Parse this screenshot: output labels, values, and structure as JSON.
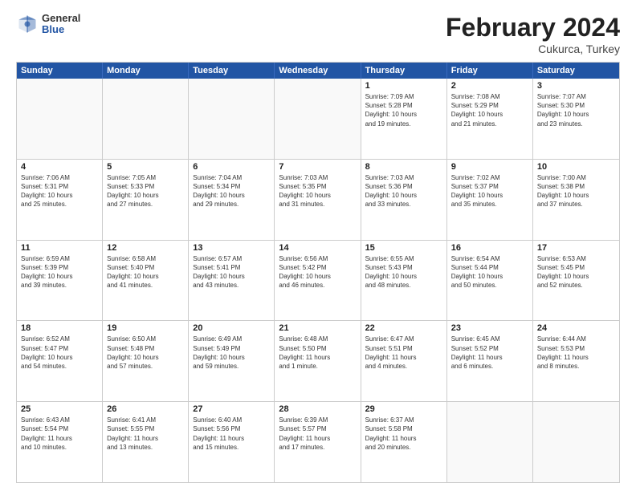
{
  "header": {
    "logo_general": "General",
    "logo_blue": "Blue",
    "title": "February 2024",
    "subtitle": "Cukurca, Turkey"
  },
  "days_of_week": [
    "Sunday",
    "Monday",
    "Tuesday",
    "Wednesday",
    "Thursday",
    "Friday",
    "Saturday"
  ],
  "weeks": [
    [
      {
        "day": "",
        "info": ""
      },
      {
        "day": "",
        "info": ""
      },
      {
        "day": "",
        "info": ""
      },
      {
        "day": "",
        "info": ""
      },
      {
        "day": "1",
        "info": "Sunrise: 7:09 AM\nSunset: 5:28 PM\nDaylight: 10 hours\nand 19 minutes."
      },
      {
        "day": "2",
        "info": "Sunrise: 7:08 AM\nSunset: 5:29 PM\nDaylight: 10 hours\nand 21 minutes."
      },
      {
        "day": "3",
        "info": "Sunrise: 7:07 AM\nSunset: 5:30 PM\nDaylight: 10 hours\nand 23 minutes."
      }
    ],
    [
      {
        "day": "4",
        "info": "Sunrise: 7:06 AM\nSunset: 5:31 PM\nDaylight: 10 hours\nand 25 minutes."
      },
      {
        "day": "5",
        "info": "Sunrise: 7:05 AM\nSunset: 5:33 PM\nDaylight: 10 hours\nand 27 minutes."
      },
      {
        "day": "6",
        "info": "Sunrise: 7:04 AM\nSunset: 5:34 PM\nDaylight: 10 hours\nand 29 minutes."
      },
      {
        "day": "7",
        "info": "Sunrise: 7:03 AM\nSunset: 5:35 PM\nDaylight: 10 hours\nand 31 minutes."
      },
      {
        "day": "8",
        "info": "Sunrise: 7:03 AM\nSunset: 5:36 PM\nDaylight: 10 hours\nand 33 minutes."
      },
      {
        "day": "9",
        "info": "Sunrise: 7:02 AM\nSunset: 5:37 PM\nDaylight: 10 hours\nand 35 minutes."
      },
      {
        "day": "10",
        "info": "Sunrise: 7:00 AM\nSunset: 5:38 PM\nDaylight: 10 hours\nand 37 minutes."
      }
    ],
    [
      {
        "day": "11",
        "info": "Sunrise: 6:59 AM\nSunset: 5:39 PM\nDaylight: 10 hours\nand 39 minutes."
      },
      {
        "day": "12",
        "info": "Sunrise: 6:58 AM\nSunset: 5:40 PM\nDaylight: 10 hours\nand 41 minutes."
      },
      {
        "day": "13",
        "info": "Sunrise: 6:57 AM\nSunset: 5:41 PM\nDaylight: 10 hours\nand 43 minutes."
      },
      {
        "day": "14",
        "info": "Sunrise: 6:56 AM\nSunset: 5:42 PM\nDaylight: 10 hours\nand 46 minutes."
      },
      {
        "day": "15",
        "info": "Sunrise: 6:55 AM\nSunset: 5:43 PM\nDaylight: 10 hours\nand 48 minutes."
      },
      {
        "day": "16",
        "info": "Sunrise: 6:54 AM\nSunset: 5:44 PM\nDaylight: 10 hours\nand 50 minutes."
      },
      {
        "day": "17",
        "info": "Sunrise: 6:53 AM\nSunset: 5:45 PM\nDaylight: 10 hours\nand 52 minutes."
      }
    ],
    [
      {
        "day": "18",
        "info": "Sunrise: 6:52 AM\nSunset: 5:47 PM\nDaylight: 10 hours\nand 54 minutes."
      },
      {
        "day": "19",
        "info": "Sunrise: 6:50 AM\nSunset: 5:48 PM\nDaylight: 10 hours\nand 57 minutes."
      },
      {
        "day": "20",
        "info": "Sunrise: 6:49 AM\nSunset: 5:49 PM\nDaylight: 10 hours\nand 59 minutes."
      },
      {
        "day": "21",
        "info": "Sunrise: 6:48 AM\nSunset: 5:50 PM\nDaylight: 11 hours\nand 1 minute."
      },
      {
        "day": "22",
        "info": "Sunrise: 6:47 AM\nSunset: 5:51 PM\nDaylight: 11 hours\nand 4 minutes."
      },
      {
        "day": "23",
        "info": "Sunrise: 6:45 AM\nSunset: 5:52 PM\nDaylight: 11 hours\nand 6 minutes."
      },
      {
        "day": "24",
        "info": "Sunrise: 6:44 AM\nSunset: 5:53 PM\nDaylight: 11 hours\nand 8 minutes."
      }
    ],
    [
      {
        "day": "25",
        "info": "Sunrise: 6:43 AM\nSunset: 5:54 PM\nDaylight: 11 hours\nand 10 minutes."
      },
      {
        "day": "26",
        "info": "Sunrise: 6:41 AM\nSunset: 5:55 PM\nDaylight: 11 hours\nand 13 minutes."
      },
      {
        "day": "27",
        "info": "Sunrise: 6:40 AM\nSunset: 5:56 PM\nDaylight: 11 hours\nand 15 minutes."
      },
      {
        "day": "28",
        "info": "Sunrise: 6:39 AM\nSunset: 5:57 PM\nDaylight: 11 hours\nand 17 minutes."
      },
      {
        "day": "29",
        "info": "Sunrise: 6:37 AM\nSunset: 5:58 PM\nDaylight: 11 hours\nand 20 minutes."
      },
      {
        "day": "",
        "info": ""
      },
      {
        "day": "",
        "info": ""
      }
    ]
  ]
}
